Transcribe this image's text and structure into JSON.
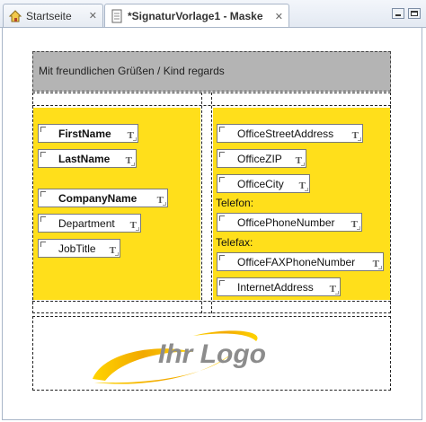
{
  "tabs": [
    {
      "label": "Startseite",
      "icon": "home-icon",
      "close": "✕"
    },
    {
      "label": "*SignaturVorlage1 - Maske",
      "icon": "document-icon",
      "close": "✕"
    }
  ],
  "header": {
    "text": "Mit freundlichen Grüßen / Kind regards"
  },
  "left_fields": {
    "first_name": "FirstName",
    "last_name": "LastName",
    "company_name": "CompanyName",
    "department": "Department",
    "job_title": "JobTitle"
  },
  "right_fields": {
    "street": "OfficeStreetAddress",
    "zip": "OfficeZIP",
    "city": "OfficeCity",
    "phone_label": "Telefon:",
    "phone": "OfficePhoneNumber",
    "fax_label": "Telefax:",
    "fax": "OfficeFAXPhoneNumber",
    "internet": "InternetAddress"
  },
  "field_type_glyph": "T",
  "logo": {
    "text": "Ihr Logo"
  },
  "colors": {
    "accent_yellow": "#ffdf1b",
    "header_gray": "#b4b4b4"
  }
}
